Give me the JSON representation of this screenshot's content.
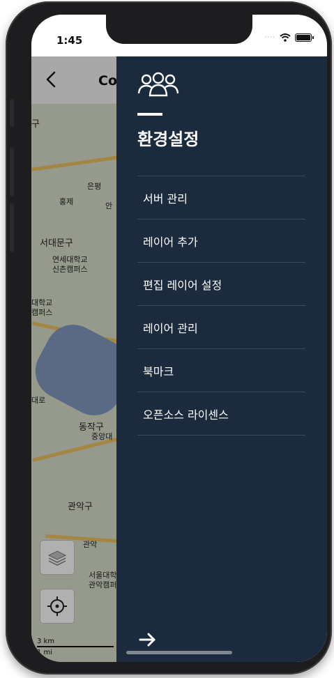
{
  "status_bar": {
    "time": "1:45"
  },
  "map": {
    "header_title": "Co",
    "labels": {
      "gu_top": "구",
      "eunpyeong_mark": "은평",
      "hongje": "홍제",
      "ansan": "안",
      "seodaemun": "서대문구",
      "yonsei": "연세대학교",
      "sinchon": "신촌캠퍼스",
      "daehakgyo": "대학교",
      "campus_left": "캠퍼스",
      "daero": "대로",
      "dongjak": "동작구",
      "jungangdae": "중앙대",
      "gwanak": "관악구",
      "gwanak_small": "관악",
      "snu": "서울대학",
      "gwanak_campus": "관악캠퍼",
      "scale_km": "3 km",
      "scale_mi": "1 mi"
    }
  },
  "drawer": {
    "title": "환경설정",
    "menu": [
      {
        "label": "서버 관리"
      },
      {
        "label": "레이어 추가"
      },
      {
        "label": "편집 레이어 설정"
      },
      {
        "label": "레이어 관리"
      },
      {
        "label": "북마크"
      },
      {
        "label": "오픈소스 라이센스"
      }
    ]
  },
  "colors": {
    "drawer_bg": "#1b2a3d",
    "divider": "#3b4a5d",
    "accent": "#ffffff"
  },
  "icons": {
    "drawer_header": "users-group-icon",
    "drawer_close": "arrow-right-icon",
    "back": "chevron-left-icon",
    "layers": "layers-icon",
    "locate": "crosshair-icon",
    "wifi": "wifi-icon",
    "battery": "battery-icon"
  }
}
